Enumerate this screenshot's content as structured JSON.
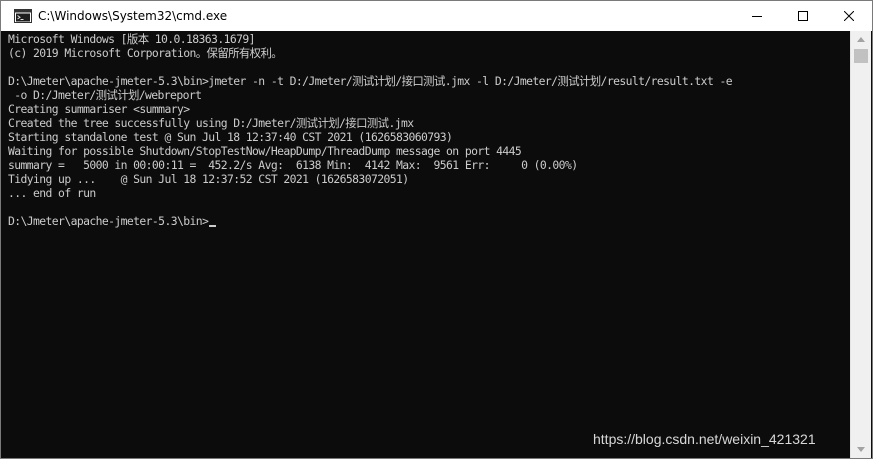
{
  "window": {
    "title": "C:\\Windows\\System32\\cmd.exe",
    "icon": "cmd-icon"
  },
  "controls": {
    "minimize": "minimize-icon",
    "maximize": "maximize-icon",
    "close": "close-icon"
  },
  "console": {
    "lines": [
      "Microsoft Windows [版本 10.0.18363.1679]",
      "(c) 2019 Microsoft Corporation。保留所有权利。",
      "",
      "D:\\Jmeter\\apache-jmeter-5.3\\bin>jmeter -n -t D:/Jmeter/测试计划/接口测试.jmx -l D:/Jmeter/测试计划/result/result.txt -e",
      " -o D:/Jmeter/测试计划/webreport",
      "Creating summariser <summary>",
      "Created the tree successfully using D:/Jmeter/测试计划/接口测试.jmx",
      "Starting standalone test @ Sun Jul 18 12:37:40 CST 2021 (1626583060793)",
      "Waiting for possible Shutdown/StopTestNow/HeapDump/ThreadDump message on port 4445",
      "summary =   5000 in 00:00:11 =  452.2/s Avg:  6138 Min:  4142 Max:  9561 Err:     0 (0.00%)",
      "Tidying up ...    @ Sun Jul 18 12:37:52 CST 2021 (1626583072051)",
      "... end of run",
      ""
    ],
    "prompt": "D:\\Jmeter\\apache-jmeter-5.3\\bin>"
  },
  "watermark": "https://blog.csdn.net/weixin_421321"
}
